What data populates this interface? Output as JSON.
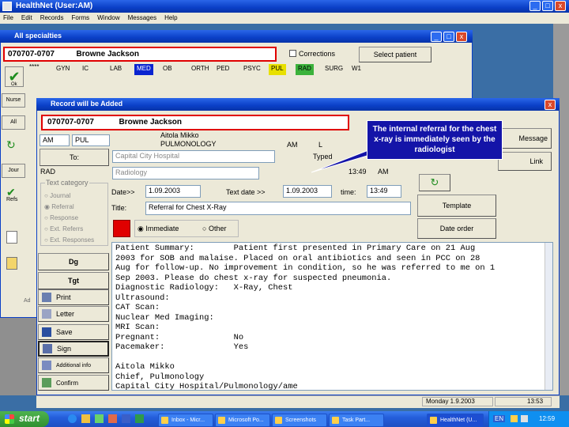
{
  "main_window": {
    "title": "HealthNet (User:AM)",
    "menu": [
      "File",
      "Edit",
      "Records",
      "Forms",
      "Window",
      "Messages",
      "Help"
    ]
  },
  "specialties_window": {
    "title": "All specialties",
    "patient_id": "070707-0707",
    "patient_name": "Browne Jackson",
    "corrections_label": "Corrections",
    "select_patient_label": "Select patient",
    "asterisks": "****",
    "specialties": [
      {
        "label": "GYN",
        "bg": ""
      },
      {
        "label": "IC",
        "bg": ""
      },
      {
        "label": "LAB",
        "bg": ""
      },
      {
        "label": "MED",
        "bg": "#0a24d0"
      },
      {
        "label": "OB",
        "bg": ""
      },
      {
        "label": "ORTH",
        "bg": ""
      },
      {
        "label": "PED",
        "bg": ""
      },
      {
        "label": "PSYC",
        "bg": ""
      },
      {
        "label": "PUL",
        "bg": "#e8e000"
      },
      {
        "label": "RAD",
        "bg": "#3bb23b"
      },
      {
        "label": "SURG",
        "bg": ""
      },
      {
        "label": "W1",
        "bg": ""
      }
    ],
    "left_buttons": [
      "Nurse",
      "All",
      "Jour",
      "Refs"
    ],
    "left_misc": [
      "Ok",
      "Ad"
    ]
  },
  "record_dialog": {
    "title": "Record will be Added",
    "patient_id": "070707-0707",
    "patient_name": "Browne Jackson",
    "user": "AM",
    "specialty": "PUL",
    "doctor_name": "Aitola Mikko",
    "doctor_dept": "PULMONOLOGY",
    "am_label": "AM",
    "l_label": "L",
    "typed_label": "Typed",
    "to_label": "To:",
    "to_value": "Capital City Hospital",
    "rad_label": "RAD",
    "radiology_value": "Radiology",
    "time_value": "13:49",
    "time_am": "AM",
    "message_label": "Message",
    "link_label": "Link",
    "text_category_label": "Text category",
    "radio_options": [
      "Journal",
      "Referral",
      "Response",
      "Ext. Referrs",
      "Ext. Responses"
    ],
    "date_label": "Date>>",
    "date_value": "1.09.2003",
    "text_date_label": "Text date >>",
    "text_date_value": "1.09.2003",
    "time_label": "time:",
    "time_field_value": "13:49",
    "title_label": "Title:",
    "title_value": "Referral for Chest X-Ray",
    "immediate_label": "Immediate",
    "other_label": "Other",
    "template_label": "Template",
    "date_order_label": "Date order",
    "body_lines": [
      "Patient Summary:        Patient first presented in Primary Care on 21 Aug",
      "2003 for SOB and malaise. Placed on oral antibiotics and seen in PCC on 28",
      "Aug for follow-up. No improvement in condition, so he was referred to me on 1",
      "Sep 2003. Please do chest x-ray for suspected pneumonia.",
      "Diagnostic Radiology:   X-Ray, Chest",
      "Ultrasound:",
      "CAT Scan:",
      "Nuclear Med Imaging:",
      "MRI Scan:",
      "Pregnant:               No",
      "Pacemaker:              Yes",
      "",
      "Aitola Mikko",
      "Chief, Pulmonology",
      "Capital City Hospital/Pulmonology/ame"
    ],
    "side_buttons": [
      "Dg",
      "Tgt",
      "Print",
      "Letter",
      "Save",
      "Sign",
      "Additional info",
      "Confirm"
    ],
    "status_date": "Monday 1.9.2003",
    "status_time": "13:53"
  },
  "callout": {
    "text": "The internal referral for the chest x-ray is immediately seen by the radiologist"
  },
  "taskbar": {
    "start_label": "start",
    "items": [
      "Inbox - Micr...",
      "Microsoft Po...",
      "Screenshots",
      "Task Part...",
      "HealthNet (U..."
    ],
    "language": "EN",
    "clock": "12:59"
  },
  "colors": {
    "xp_blue": "#0a3fc7",
    "highlight_red": "#e00000",
    "callout_blue": "#1414a8"
  }
}
